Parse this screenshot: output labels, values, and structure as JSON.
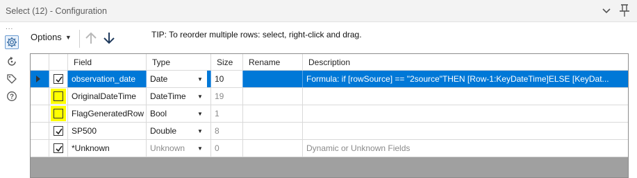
{
  "window": {
    "title": "Select (12) - Configuration",
    "icons": [
      "chevron-down-icon",
      "pin-icon"
    ]
  },
  "sidebar": {
    "dots": "...",
    "icons": [
      "gear-icon",
      "refresh-connection-icon",
      "tag-icon",
      "help-icon"
    ]
  },
  "toolbar": {
    "options_label": "Options",
    "move_up_icon": "arrow-up-icon",
    "move_down_icon": "arrow-down-icon",
    "tip": "TIP: To reorder multiple rows: select, right-click and drag."
  },
  "grid": {
    "columns": [
      "Field",
      "Type",
      "Size",
      "Rename",
      "Description"
    ],
    "rows": [
      {
        "checked": true,
        "highlight": false,
        "selected": true,
        "field": "observation_date",
        "type": "Date",
        "size": "10",
        "rename": "",
        "description": "Formula: if [rowSource] == \"2source\"THEN [Row-1:KeyDateTime]ELSE [KeyDat...",
        "muted": false
      },
      {
        "checked": false,
        "highlight": true,
        "selected": false,
        "field": "OriginalDateTime",
        "type": "DateTime",
        "size": "19",
        "rename": "",
        "description": "",
        "muted": false
      },
      {
        "checked": false,
        "highlight": true,
        "selected": false,
        "field": "FlagGeneratedRow",
        "type": "Bool",
        "size": "1",
        "rename": "",
        "description": "",
        "muted": false
      },
      {
        "checked": true,
        "highlight": false,
        "selected": false,
        "field": "SP500",
        "type": "Double",
        "size": "8",
        "rename": "",
        "description": "",
        "muted": false
      },
      {
        "checked": true,
        "highlight": false,
        "selected": false,
        "field": "*Unknown",
        "type": "Unknown",
        "size": "0",
        "rename": "",
        "description": "Dynamic or Unknown Fields",
        "muted": true
      }
    ]
  },
  "colors": {
    "selection": "#0078d7",
    "highlight": "#ffff00",
    "grid_empty": "#a0a0a0"
  }
}
